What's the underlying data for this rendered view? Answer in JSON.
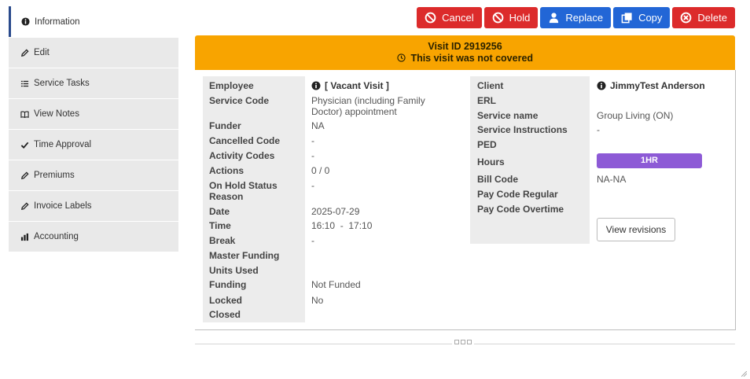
{
  "sidebar": {
    "items": [
      {
        "label": "Information",
        "icon": "info-icon"
      },
      {
        "label": "Edit",
        "icon": "pencil-icon"
      },
      {
        "label": "Service Tasks",
        "icon": "task-list-icon"
      },
      {
        "label": "View Notes",
        "icon": "book-icon"
      },
      {
        "label": "Time Approval",
        "icon": "check-icon"
      },
      {
        "label": "Premiums",
        "icon": "pencil-icon"
      },
      {
        "label": "Invoice Labels",
        "icon": "pencil-icon"
      },
      {
        "label": "Accounting",
        "icon": "bar-chart-icon"
      }
    ]
  },
  "toolbar": {
    "cancel": "Cancel",
    "hold": "Hold",
    "replace": "Replace",
    "copy": "Copy",
    "delete": "Delete",
    "colors": {
      "red": "#dc2b2b",
      "blue": "#2266d6"
    }
  },
  "banner": {
    "title": "Visit ID 2919256",
    "status": "This visit was not covered",
    "color": "#f8a400"
  },
  "details": {
    "left": [
      {
        "label": "Employee",
        "value": "[ Vacant Visit ]"
      },
      {
        "label": "Service Code",
        "value": "Physician (including Family Doctor) appointment"
      },
      {
        "label": "Funder",
        "value": "NA"
      },
      {
        "label": "Cancelled Code",
        "value": "-"
      },
      {
        "label": "Activity Codes",
        "value": "-"
      },
      {
        "label": "Actions",
        "value": "0 / 0"
      },
      {
        "label": "On Hold Status Reason",
        "value": "-"
      },
      {
        "label": "Date",
        "value": "2025-07-29"
      },
      {
        "label": "Time",
        "value": "16:10  -  17:10"
      },
      {
        "label": "Break",
        "value": "-"
      },
      {
        "label": "Master Funding",
        "value": ""
      },
      {
        "label": "Units Used",
        "value": ""
      },
      {
        "label": "Funding",
        "value": "Not Funded"
      },
      {
        "label": "Locked",
        "value": "No"
      },
      {
        "label": "Closed",
        "value": ""
      }
    ],
    "right": [
      {
        "label": "Client",
        "value": "JimmyTest Anderson"
      },
      {
        "label": "ERL",
        "value": ""
      },
      {
        "label": "Service name",
        "value": "Group Living (ON)"
      },
      {
        "label": "Service Instructions",
        "value": "-"
      },
      {
        "label": "PED",
        "value": ""
      },
      {
        "label": "Hours",
        "value": "1HR"
      },
      {
        "label": "Bill Code",
        "value": "NA-NA"
      },
      {
        "label": "Pay Code Regular",
        "value": ""
      },
      {
        "label": "Pay Code Overtime",
        "value": ""
      }
    ],
    "hours_badge_color": "#8d5ad6",
    "view_revisions": "View revisions"
  }
}
